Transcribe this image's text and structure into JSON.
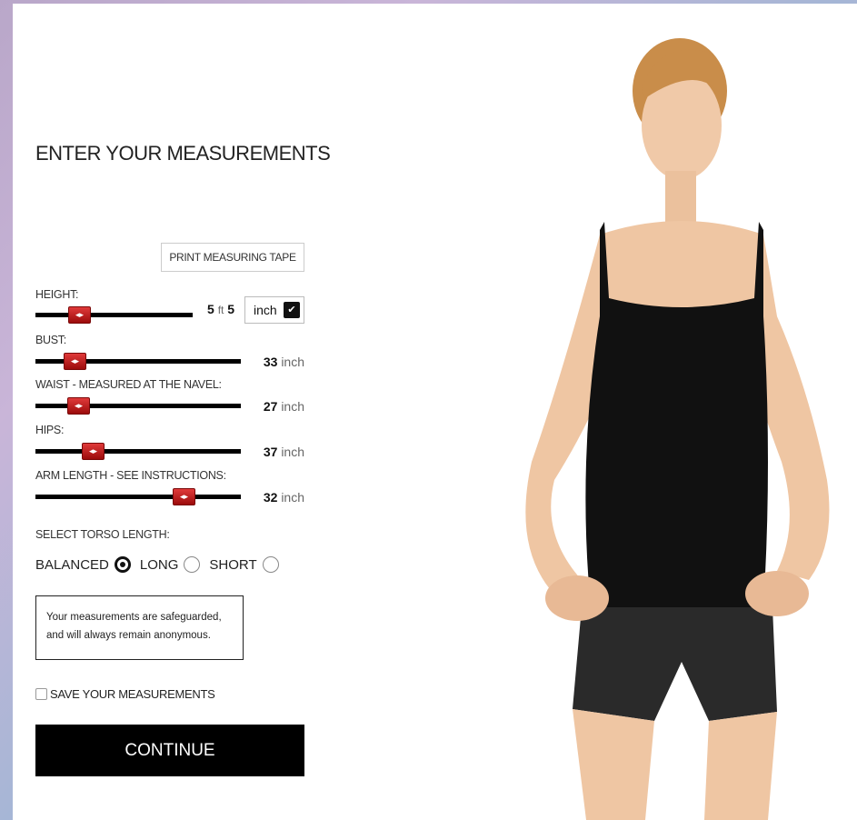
{
  "title": "ENTER YOUR MEASUREMENTS",
  "print_button": "PRINT MEASURING TAPE",
  "thumb_glyph": "◂▸",
  "height": {
    "label": "HEIGHT:",
    "feet": "5",
    "feet_unit": "ft",
    "inches": "5",
    "unit_select": "inch",
    "fraction": 0.28
  },
  "sliders": [
    {
      "label": "BUST:",
      "value": "33",
      "unit": "inch",
      "fraction": 0.19
    },
    {
      "label": "WAIST - MEASURED AT THE NAVEL:",
      "value": "27",
      "unit": "inch",
      "fraction": 0.21
    },
    {
      "label": "HIPS:",
      "value": "37",
      "unit": "inch",
      "fraction": 0.28
    },
    {
      "label": "ARM LENGTH - SEE INSTRUCTIONS:",
      "value": "32",
      "unit": "inch",
      "fraction": 0.72
    }
  ],
  "torso": {
    "label": "SELECT TORSO LENGTH:",
    "options": [
      {
        "label": "BALANCED",
        "selected": true
      },
      {
        "label": "LONG",
        "selected": false
      },
      {
        "label": "SHORT",
        "selected": false
      }
    ]
  },
  "notice": "Your measurements are safeguarded, and will always remain anonymous.",
  "save_label": "SAVE YOUR MEASUREMENTS",
  "continue_label": "CONTINUE",
  "colors": {
    "slider_thumb": "#c41414",
    "button_bg": "#000000"
  }
}
